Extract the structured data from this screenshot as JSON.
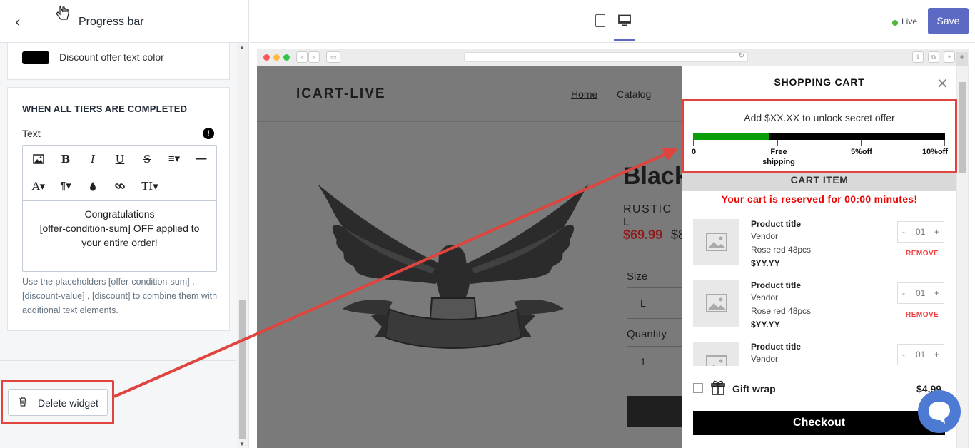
{
  "panel": {
    "title": "Progress bar",
    "color_label": "Discount offer text color",
    "section_heading": "WHEN ALL TIERS ARE COMPLETED",
    "text_label": "Text",
    "editor_lines": [
      "Congratulations",
      "[offer-condition-sum] OFF applied to",
      "your entire order!"
    ],
    "help_text": "Use the placeholders [offer-condition-sum] , [discount-value] , [discount] to combine them with additional text elements.",
    "delete_label": "Delete widget"
  },
  "topbar": {
    "status": "Live",
    "save_label": "Save"
  },
  "store": {
    "logo": "ICART-LIVE",
    "nav": [
      "Home",
      "Catalog"
    ],
    "product_title": "Black",
    "vendor": "RUSTIC L",
    "price": "$69.99",
    "compare_price": "$8",
    "size_label": "Size",
    "size_value": "L",
    "qty_label": "Quantity",
    "qty_value": "1"
  },
  "cart": {
    "title": "SHOPPING CART",
    "progress_text": "Add $XX.XX to unlock secret offer",
    "progress_fraction": 0.3,
    "tiers": [
      {
        "label_top": "0",
        "label_bottom": ""
      },
      {
        "label_top": "Free",
        "label_bottom": "shipping"
      },
      {
        "label_top": "5%off",
        "label_bottom": ""
      },
      {
        "label_top": "10%off",
        "label_bottom": ""
      }
    ],
    "item_header": "CART ITEM",
    "reserve_text": "Your cart is reserved for 00:00 minutes!",
    "items": [
      {
        "title": "Product title",
        "vendor": "Vendor",
        "option": "Rose red 48pcs",
        "price": "$YY.YY",
        "qty": "01",
        "remove": "REMOVE"
      },
      {
        "title": "Product title",
        "vendor": "Vendor",
        "option": "Rose red 48pcs",
        "price": "$YY.YY",
        "qty": "01",
        "remove": "REMOVE"
      },
      {
        "title": "Product title",
        "vendor": "Vendor",
        "option": "",
        "price": "",
        "qty": "01",
        "remove": ""
      }
    ],
    "gift_label": "Gift wrap",
    "gift_price": "$4.99",
    "checkout_label": "Checkout"
  },
  "colors": {
    "accent": "#5c6ac4",
    "progress_fill": "#0b9e0b",
    "highlight": "#e0443e",
    "reserve": "#ee0000",
    "live": "#50b83c"
  }
}
